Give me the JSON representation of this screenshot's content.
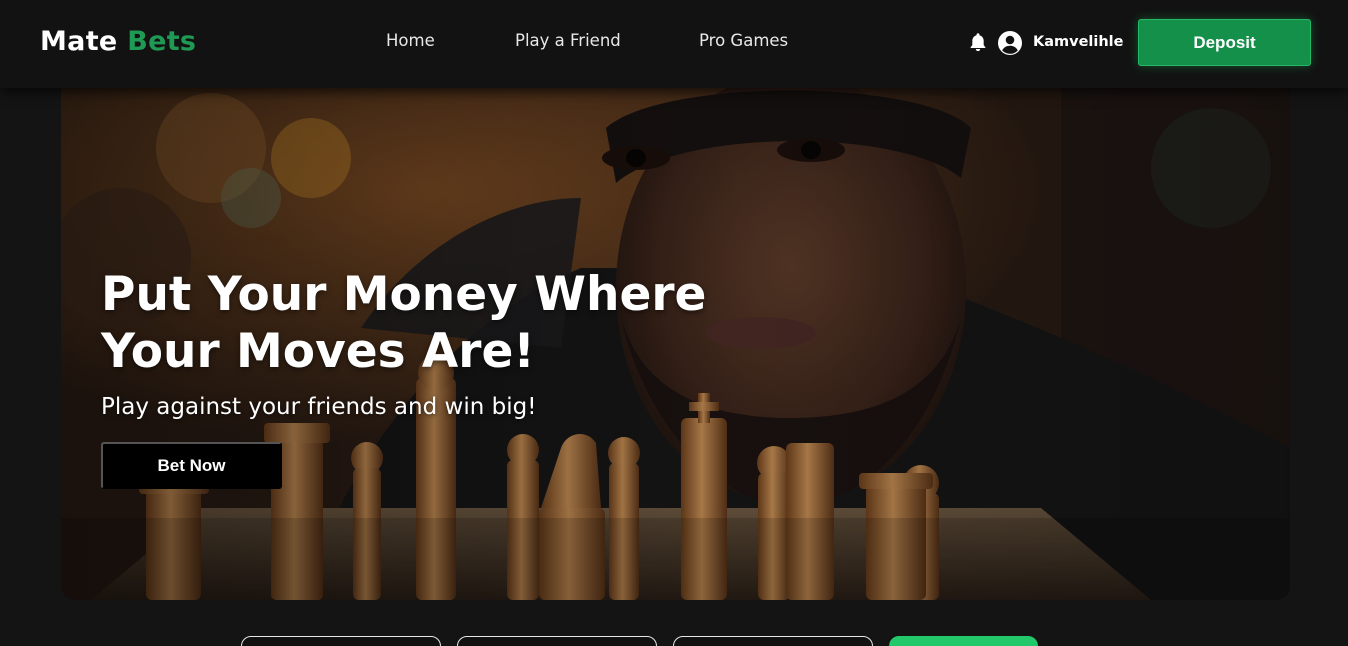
{
  "brand": {
    "name_part1": "Mate",
    "name_part2": "Bets",
    "accent_color": "#1f9a55"
  },
  "nav": {
    "links": [
      {
        "label": "Home"
      },
      {
        "label": "Play a Friend"
      },
      {
        "label": "Pro Games"
      }
    ],
    "notification_icon": "bell-icon",
    "user_icon": "user-circle-icon",
    "username": "Kamvelihle",
    "deposit_label": "Deposit",
    "deposit_color": "#14904b"
  },
  "hero": {
    "title": "Put Your Money Where Your Moves Are!",
    "subtitle": "Play against your friends and win big!",
    "cta_label": "Bet Now"
  },
  "tabs": {
    "active_color": "#22c86a"
  }
}
